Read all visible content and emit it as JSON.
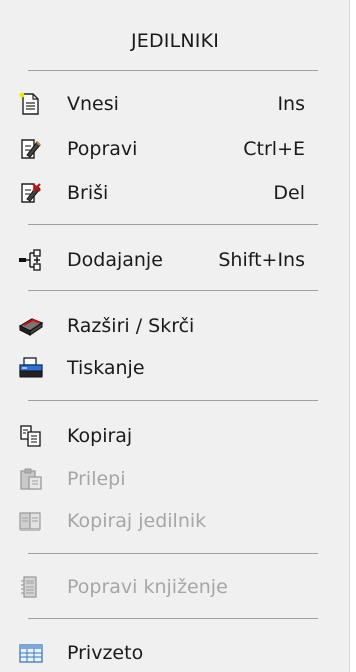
{
  "menu": {
    "title": "JEDILNIKI",
    "items": [
      {
        "label": "Vnesi",
        "shortcut": "Ins",
        "icon": "new-document-icon",
        "enabled": true
      },
      {
        "label": "Popravi",
        "shortcut": "Ctrl+E",
        "icon": "edit-document-icon",
        "enabled": true
      },
      {
        "label": "Briši",
        "shortcut": "Del",
        "icon": "delete-document-icon",
        "enabled": true
      },
      {
        "label": "Dodajanje",
        "shortcut": "Shift+Ins",
        "icon": "add-node-icon",
        "enabled": true
      },
      {
        "label": "Razširi / Skrči",
        "shortcut": "",
        "icon": "expand-collapse-icon",
        "enabled": true
      },
      {
        "label": "Tiskanje",
        "shortcut": "",
        "icon": "printer-icon",
        "enabled": true
      },
      {
        "label": "Kopiraj",
        "shortcut": "",
        "icon": "copy-icon",
        "enabled": true
      },
      {
        "label": "Prilepi",
        "shortcut": "",
        "icon": "paste-icon",
        "enabled": false
      },
      {
        "label": "Kopiraj jedilnik",
        "shortcut": "",
        "icon": "copy-menu-icon",
        "enabled": false
      },
      {
        "label": "Popravi knjiženje",
        "shortcut": "",
        "icon": "edit-posting-icon",
        "enabled": false
      },
      {
        "label": "Privzeto",
        "shortcut": "",
        "icon": "table-icon",
        "enabled": true
      }
    ]
  }
}
